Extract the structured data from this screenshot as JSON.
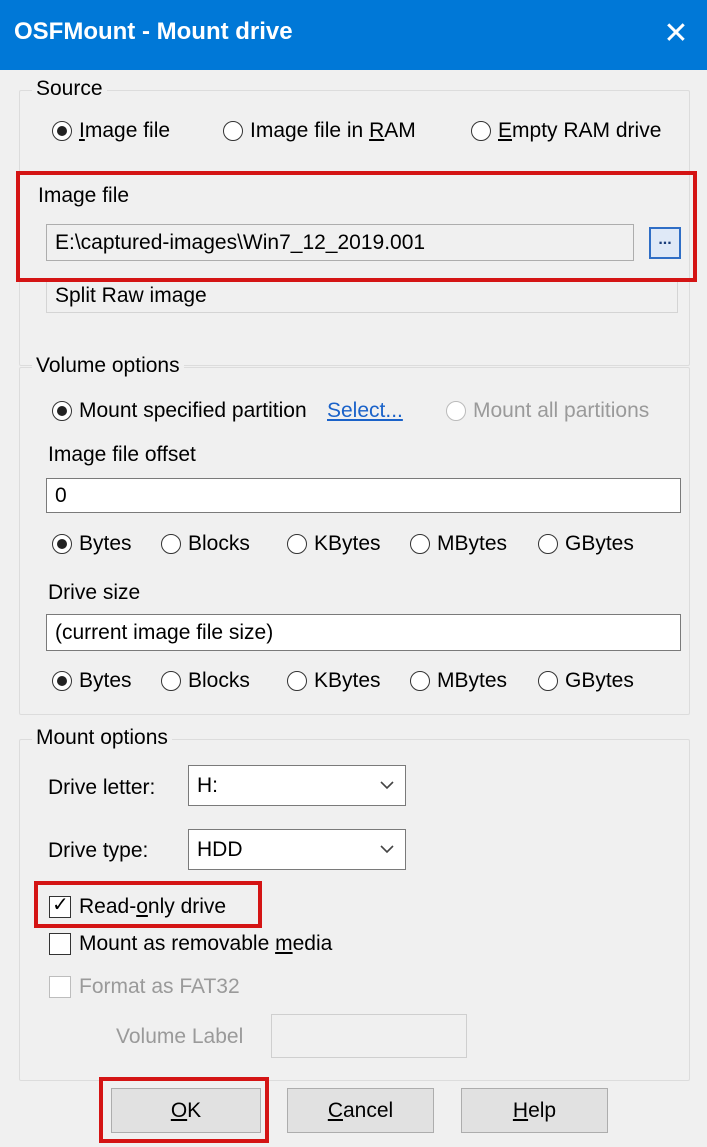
{
  "window": {
    "title": "OSFMount - Mount drive",
    "close_glyph": "✕"
  },
  "source": {
    "legend": "Source",
    "options": [
      {
        "label": "Image file",
        "mnemonic": "I",
        "rest": "mage file",
        "selected": true
      },
      {
        "label": "Image file in RAM",
        "pre": "Image file in ",
        "mnemonic": "R",
        "rest": "AM",
        "selected": false
      },
      {
        "label": "Empty RAM drive",
        "mnemonic": "E",
        "rest": "mpty RAM drive",
        "selected": false
      }
    ]
  },
  "image_file": {
    "legend": "Image file",
    "path": "E:\\captured-images\\Win7_12_2019.001",
    "browse_label": "...",
    "type_text": "Split Raw image"
  },
  "volume": {
    "legend": "Volume options",
    "mount_specified": "Mount specified partition",
    "select_link": "Select...",
    "mount_all": "Mount all partitions",
    "offset_label": "Image file offset",
    "offset_value": "0",
    "drive_size_label": "Drive size",
    "drive_size_value": "(current image file size)",
    "units": [
      "Bytes",
      "Blocks",
      "KBytes",
      "MBytes",
      "GBytes"
    ],
    "offset_unit_selected": "Bytes",
    "size_unit_selected": "Bytes"
  },
  "mount": {
    "legend": "Mount options",
    "drive_letter_label": "Drive letter:",
    "drive_letter_value": "H:",
    "drive_type_label": "Drive type:",
    "drive_type_value": "HDD",
    "readonly": {
      "pre": "Read-",
      "mnemonic": "o",
      "rest": "nly drive",
      "checked": true
    },
    "removable": {
      "pre": "Mount as removable ",
      "mnemonic": "m",
      "rest": "edia",
      "checked": false
    },
    "fat32": {
      "label": "Format as FAT32",
      "checked": false,
      "enabled": false
    },
    "volume_label": "Volume Label",
    "volume_label_value": ""
  },
  "buttons": {
    "ok": {
      "mnemonic": "O",
      "rest": "K"
    },
    "cancel": {
      "mnemonic": "C",
      "rest": "ancel"
    },
    "help": {
      "mnemonic": "H",
      "rest": "elp"
    }
  },
  "colors": {
    "titlebar": "#0078d7",
    "highlight": "#d41414",
    "link": "#1a62c9"
  }
}
